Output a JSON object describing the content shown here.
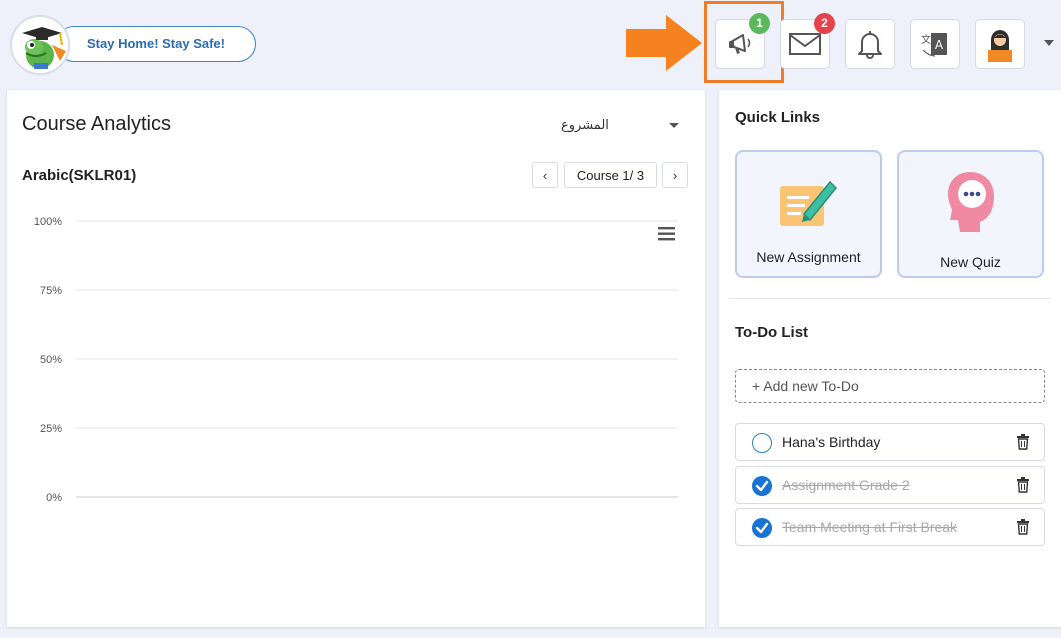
{
  "header": {
    "slogan": "Stay Home! Stay Safe!",
    "announcements_badge": "1",
    "messages_badge": "2",
    "announcements_badge_color": "#5cb85c",
    "messages_badge_color": "#e5434b",
    "highlight_color": "#ee7c28",
    "icons": [
      "megaphone-icon",
      "envelope-icon",
      "bell-icon",
      "translate-icon",
      "teacher-avatar-icon",
      "caret-down-icon"
    ]
  },
  "analytics": {
    "title": "Course Analytics",
    "project_select": "المشروع",
    "course_name": "Arabic(SKLR01)",
    "pager_prev": "‹",
    "pager_label": "Course 1/ 3",
    "pager_next": "›"
  },
  "chart_data": {
    "type": "bar",
    "categories": [],
    "series": [],
    "ylim": [
      0,
      100
    ],
    "y_ticks": [
      "100%",
      "75%",
      "50%",
      "25%",
      "0%"
    ],
    "grid": true,
    "title": "",
    "xlabel": "",
    "ylabel": ""
  },
  "quick_links": {
    "title": "Quick Links",
    "items": [
      {
        "label": "New Assignment",
        "icon": "assignment-pen-icon"
      },
      {
        "label": "New Quiz",
        "icon": "quiz-head-icon"
      }
    ]
  },
  "todo": {
    "title": "To-Do List",
    "add_placeholder": "+ Add new To-Do",
    "items": [
      {
        "text": "Hana's Birthday",
        "done": false
      },
      {
        "text": "Assignment Grade 2",
        "done": true
      },
      {
        "text": "Team Meeting at First Break",
        "done": true
      }
    ],
    "accent": "#1773d4"
  }
}
